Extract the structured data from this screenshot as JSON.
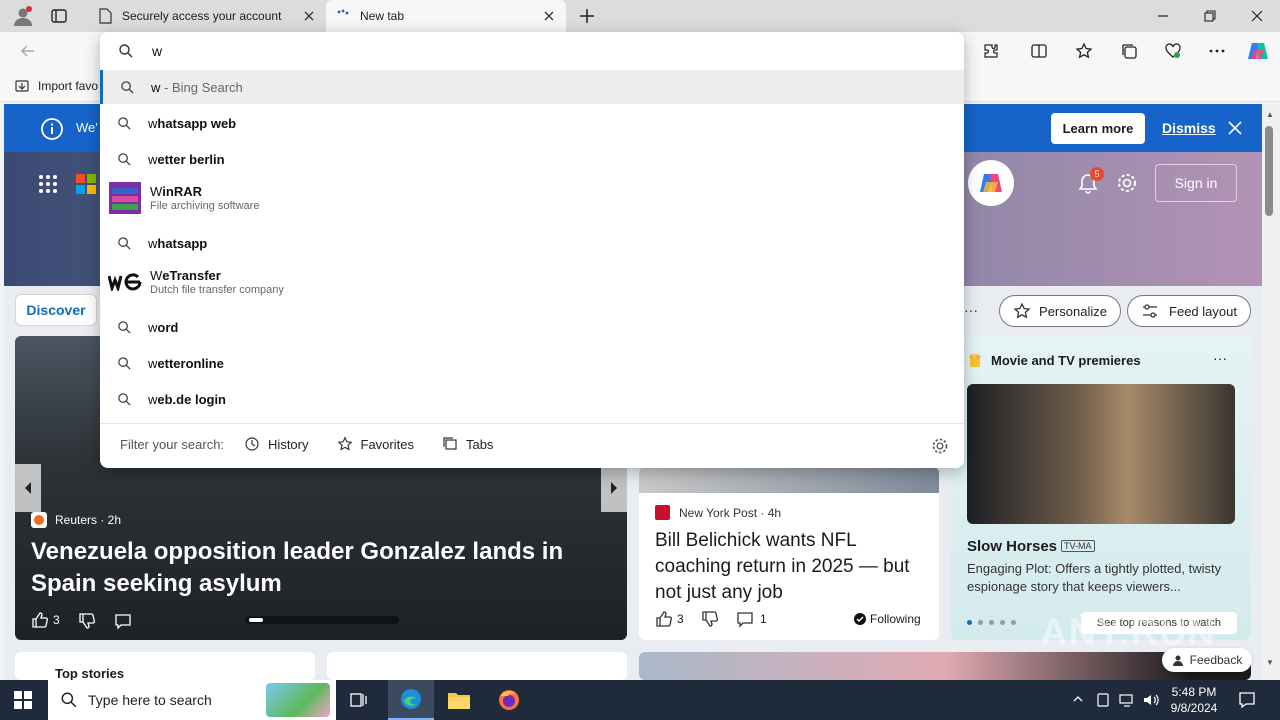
{
  "browser": {
    "tabs": [
      {
        "title": "Securely access your account"
      },
      {
        "title": "New tab"
      }
    ],
    "address_value": "w",
    "favorites_bar": {
      "import_label": "Import favo"
    }
  },
  "suggestions": {
    "items": [
      {
        "prefix": "w",
        "rest": " - Bing Search",
        "sub": "",
        "icon": "search-icon"
      },
      {
        "prefix": "w",
        "rest": "hatsapp web",
        "sub": "",
        "icon": "search-icon"
      },
      {
        "prefix": "w",
        "rest": "etter berlin",
        "sub": "",
        "icon": "search-icon"
      },
      {
        "prefix": "W",
        "rest": "inRAR",
        "sub": "File archiving software",
        "icon": "winrar-icon"
      },
      {
        "prefix": "w",
        "rest": "hatsapp",
        "sub": "",
        "icon": "search-icon"
      },
      {
        "prefix": "W",
        "rest": "eTransfer",
        "sub": "Dutch file transfer company",
        "icon": "wetransfer-icon"
      },
      {
        "prefix": "w",
        "rest": "ord",
        "sub": "",
        "icon": "search-icon"
      },
      {
        "prefix": "w",
        "rest": "etteronline",
        "sub": "",
        "icon": "search-icon"
      },
      {
        "prefix": "w",
        "rest": "eb.de login",
        "sub": "",
        "icon": "search-icon"
      }
    ],
    "filter_label": "Filter your search:",
    "filter_history": "History",
    "filter_favorites": "Favorites",
    "filter_tabs": "Tabs"
  },
  "banner": {
    "text": "We'",
    "learn_more": "Learn more",
    "dismiss": "Dismiss"
  },
  "header": {
    "notification_count": "5",
    "sign_in": "Sign in"
  },
  "feed": {
    "discover_tab": "Discover",
    "personalize": "Personalize",
    "feed_layout": "Feed layout",
    "hero_story": {
      "source": "Reuters · 2h",
      "headline": "Venezuela opposition leader Gonzalez lands in Spain seeking asylum",
      "likes": "3"
    },
    "story2": {
      "source": "New York Post · 4h",
      "headline": "Bill Belichick wants NFL coaching return in 2025 — but not just any job",
      "likes": "3",
      "comments": "1",
      "following": "Following"
    },
    "movie_card": {
      "title": "Movie and TV premieres",
      "show": "Slow Horses",
      "rating": "TV-MA",
      "desc": "Engaging Plot: Offers a tightly plotted, twisty espionage story that keeps viewers...",
      "cta": "See top reasons to watch"
    },
    "top_stories": "Top stories",
    "feedback": "Feedback"
  },
  "watermark": "ANY.RUN",
  "taskbar": {
    "search_placeholder": "Type here to search",
    "time": "5:48 PM",
    "date": "9/8/2024"
  },
  "colors": {
    "banner_blue": "#1664c9",
    "accent": "#0067c0"
  }
}
